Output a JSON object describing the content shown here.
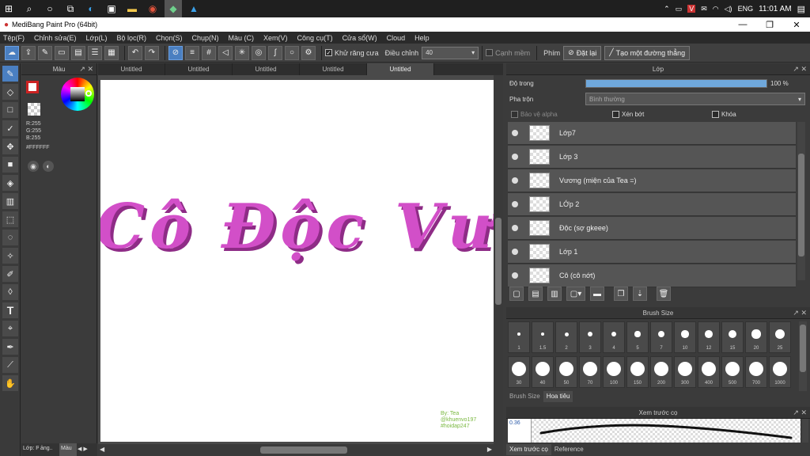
{
  "taskbar": {
    "clock": "11:01 AM",
    "lang": "ENG"
  },
  "window": {
    "title": "MediBang Paint Pro (64bit)"
  },
  "menu": [
    "Tệp(F)",
    "Chỉnh sửa(E)",
    "Lớp(L)",
    "Bộ lọc(R)",
    "Chọn(S)",
    "Chụp(N)",
    "Màu (C)",
    "Xem(V)",
    "Công cụ(T)",
    "Cửa sổ(W)",
    "Cloud",
    "Help"
  ],
  "toolbar": {
    "antialias_label": "Khử răng cưa",
    "adjust_label": "Điều chỉnh",
    "adjust_value": "40",
    "smooth_label": "Cạnh mềm",
    "key_label": "Phím",
    "reset_label": "Đặt lại",
    "straight_line_label": "Tạo một đường thẳng"
  },
  "color_panel": {
    "title": "Màu",
    "r": "R:255",
    "g": "G:255",
    "b": "B:255",
    "hex": "#FFFFFF",
    "bottom_tabs": [
      "Lớp: P..",
      "ảng..",
      "Màu"
    ]
  },
  "tabs": [
    "Untitled",
    "Untitled",
    "Untitled",
    "Untitled",
    "Untitled"
  ],
  "canvas": {
    "art_text": "Cô Độc Vương",
    "credit": [
      "By: Tea",
      "@khuenvo197",
      "#hoidap247"
    ]
  },
  "layer_panel": {
    "title": "Lớp",
    "opacity_label": "Độ trong",
    "opacity_value": "100 %",
    "opacity_fraction": 1.0,
    "blend_label": "Pha trộn",
    "blend_value": "Bình thường",
    "protect_alpha": "Bảo vệ alpha",
    "clipping": "Xén bớt",
    "lock": "Khóa",
    "layers": [
      "Lớp7",
      "Lớp 3",
      "Vương (miện của Tea =)",
      "LỚp 2",
      "Độc (sợ gkeee)",
      "Lớp 1",
      "Cô (cô nớt)"
    ]
  },
  "brush_panel": {
    "title": "Brush Size",
    "sizes": [
      "1",
      "1.5",
      "2",
      "3",
      "4",
      "5",
      "7",
      "10",
      "12",
      "15",
      "20",
      "25",
      "30",
      "40",
      "50",
      "70",
      "100",
      "150",
      "200",
      "300",
      "400",
      "500",
      "700",
      "1000"
    ],
    "tabs": [
      "Brush Size",
      "Hoa tiêu"
    ]
  },
  "preview_panel": {
    "title": "Xem trước cọ",
    "value": "0.36",
    "tabs": [
      "Xem trước cọ",
      "Reference"
    ]
  },
  "colors": {
    "accent": "#4a7fc1",
    "art": "#d24fc8",
    "art_shadow": "#8e2c86",
    "foreground": "#cc2222"
  }
}
